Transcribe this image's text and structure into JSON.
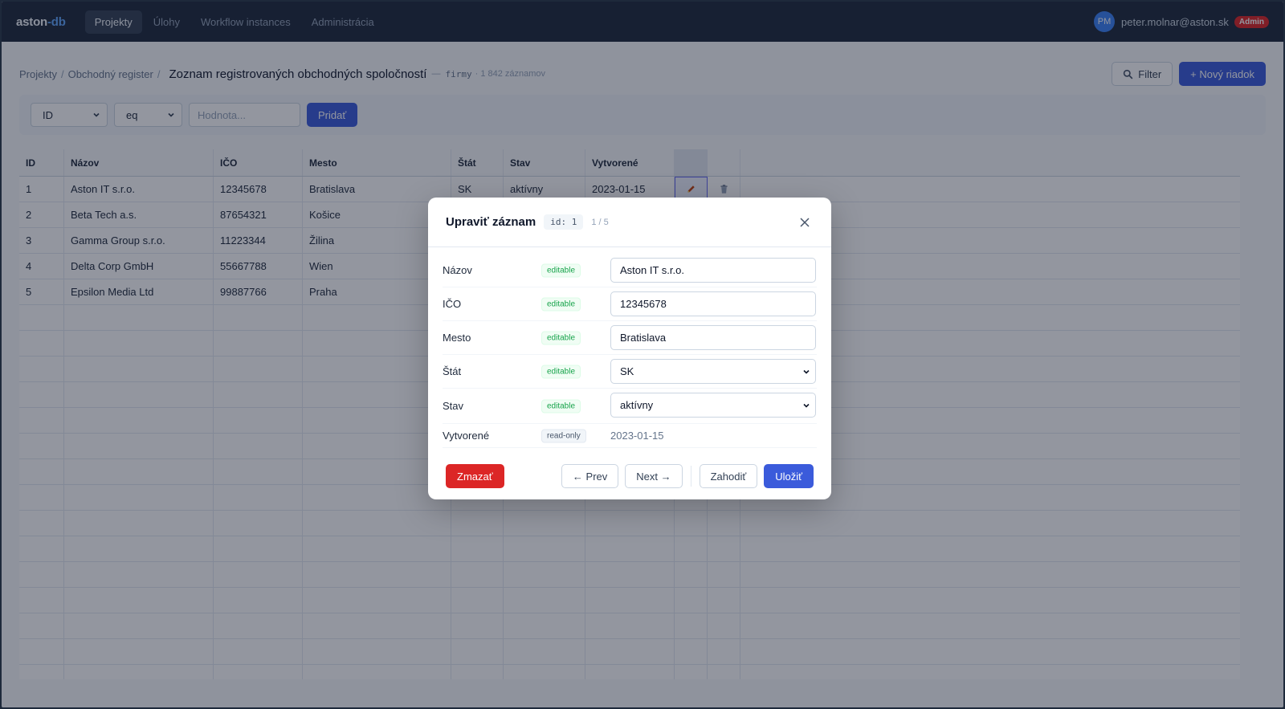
{
  "nav": {
    "logo_prefix": "aston",
    "logo_suffix": "-db",
    "tabs": [
      {
        "label": "Projekty",
        "active": true
      },
      {
        "label": "Úlohy",
        "active": false
      },
      {
        "label": "Workflow instances",
        "active": false
      },
      {
        "label": "Administrácia",
        "active": false
      }
    ],
    "user": {
      "initials": "PM",
      "email": "peter.molnar@aston.sk",
      "role": "Admin"
    }
  },
  "breadcrumb": {
    "items": [
      "Projekty",
      "Obchodný register"
    ],
    "sep": "/",
    "title": "Zoznam registrovaných obchodných spoločností",
    "meta_sep": "—",
    "table_name": "firmy",
    "count": "· 1 842 záznamov"
  },
  "actions": {
    "filter": "Filter",
    "new_row": "+ Nový riadok"
  },
  "filter": {
    "field": "ID",
    "operator": "eq",
    "value_placeholder": "Hodnota...",
    "add_label": "Pridať"
  },
  "table": {
    "columns": [
      "ID",
      "Názov",
      "IČO",
      "Mesto",
      "Štát",
      "Stav",
      "Vytvorené"
    ],
    "rows": [
      {
        "id": "1",
        "nazov": "Aston IT s.r.o.",
        "ico": "12345678",
        "mesto": "Bratislava",
        "stat": "SK",
        "stav": "aktívny",
        "vytvorene": "2023-01-15"
      },
      {
        "id": "2",
        "nazov": "Beta Tech a.s.",
        "ico": "87654321",
        "mesto": "Košice",
        "stat": "",
        "stav": "",
        "vytvorene": ""
      },
      {
        "id": "3",
        "nazov": "Gamma Group s.r.o.",
        "ico": "11223344",
        "mesto": "Žilina",
        "stat": "",
        "stav": "",
        "vytvorene": ""
      },
      {
        "id": "4",
        "nazov": "Delta Corp GmbH",
        "ico": "55667788",
        "mesto": "Wien",
        "stat": "",
        "stav": "",
        "vytvorene": ""
      },
      {
        "id": "5",
        "nazov": "Epsilon Media Ltd",
        "ico": "99887766",
        "mesto": "Praha",
        "stat": "",
        "stav": "",
        "vytvorene": ""
      }
    ]
  },
  "modal": {
    "title": "Upraviť záznam",
    "id_badge": "id: 1",
    "position": "1 / 5",
    "fields": [
      {
        "label": "Názov",
        "tag": "editable",
        "value": "Aston IT s.r.o."
      },
      {
        "label": "IČO",
        "tag": "editable",
        "value": "12345678"
      },
      {
        "label": "Mesto",
        "tag": "editable",
        "value": "Bratislava"
      },
      {
        "label": "Štát",
        "tag": "editable",
        "value": "SK"
      },
      {
        "label": "Stav",
        "tag": "editable",
        "value": "aktívny"
      },
      {
        "label": "Vytvorené",
        "tag": "read-only",
        "value": "2023-01-15"
      }
    ],
    "buttons": {
      "delete": "Zmazať",
      "prev": "← Prev",
      "next": "Next →",
      "discard": "Zahodiť",
      "save": "Uložiť"
    }
  },
  "colors": {
    "primary": "#3b5bdb",
    "danger": "#dc2626",
    "nav_bg": "#1e293b",
    "editable_tag": "#16a34a"
  }
}
